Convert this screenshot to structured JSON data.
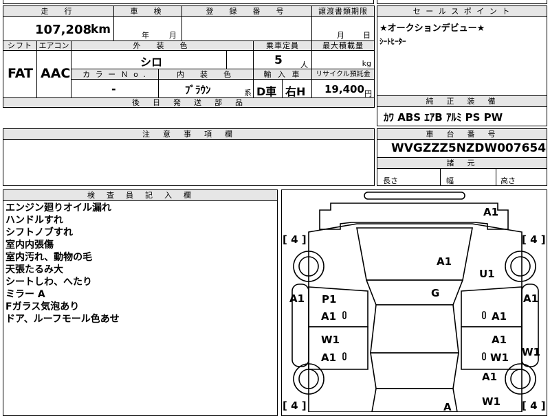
{
  "top": {
    "mileage_label": "走　行",
    "mileage_value": "107,208",
    "mileage_unit": "km",
    "inspection_label": "車　検",
    "inspection_year": "年",
    "inspection_month": "月",
    "registration_label": "登　録　番　号",
    "transfer_label": "譲渡書類期限",
    "transfer_month": "月",
    "transfer_day": "日"
  },
  "spec": {
    "shift_label": "シフト",
    "shift_value": "FAT",
    "aircon_label": "エアコン",
    "aircon_value": "AAC",
    "exterior_color_label": "外　装　色",
    "exterior_color_value": "シロ",
    "capacity_label": "乗車定員",
    "capacity_value": "5",
    "capacity_unit": "人",
    "max_load_label": "最大積載量",
    "max_load_unit": "kg",
    "color_no_label": "カ ラ ー Ｎ o .",
    "color_no_value": "-",
    "interior_color_label": "内　装　色",
    "interior_color_value": "ﾌﾞﾗｳﾝ",
    "interior_color_suffix": "系",
    "import_label": "輸 入 車",
    "import_type": "D車",
    "steering": "右H",
    "recycle_label": "リサイクル預託金",
    "recycle_value": "19,400",
    "recycle_unit": "円",
    "later_shipping_label": "後　日　発　送　部　品"
  },
  "sales_point": {
    "label": "セ ー ル ス ポ イ ン ト",
    "line1": "★オークションデビュー★",
    "line2": "ｼｰﾄﾋｰﾀｰ"
  },
  "equipment": {
    "label": "純　正　装　備",
    "value": "ｶﾜ ABS ｴｱB ｱﾙﾐ PS PW"
  },
  "notes": {
    "label": "注　意　事　項　欄"
  },
  "chassis": {
    "label": "車　台　番　号",
    "value": "WVGZZZ5NZDW007654",
    "dimensions_label": "諸　元",
    "length_label": "長さ",
    "width_label": "幅",
    "height_label": "高さ"
  },
  "inspector": {
    "label": "検　査　員　記　入　欄",
    "lines": [
      "エンジン廻りオイル漏れ",
      "ハンドルすれ",
      "シフトノブすれ",
      "室内内張傷",
      "室内汚れ、動物の毛",
      "天張たるみ大",
      "シートしわ、へたり",
      "ミラー A",
      "Fガラス気泡あり",
      "ドア、ルーフモール色あせ"
    ]
  },
  "diagram": {
    "tyre_fl": "[ 4 ]",
    "tyre_fr": "[ 4 ]",
    "tyre_rl": "[ 4 ]",
    "tyre_rr": "[ 4 ]",
    "mark_front_bumper": "A1",
    "mark_bonnet": "A1",
    "mark_front_right_fender": "U1",
    "mark_windshield": "G",
    "mark_left_fender": "A1",
    "mark_right_fender": "A1",
    "mark_left_pillar": "P1",
    "mark_left_front_door": "A1",
    "mark_right_front_door": "A1",
    "mark_left_rear_door_top": "W1",
    "mark_left_rear_door": "A1",
    "mark_right_rear_door_top": "A1",
    "mark_right_rear_door": "W1",
    "mark_right_quarter": "W1",
    "mark_right_rear_upper": "A1",
    "mark_right_rear_lower": "W1",
    "mark_rear": "A"
  }
}
